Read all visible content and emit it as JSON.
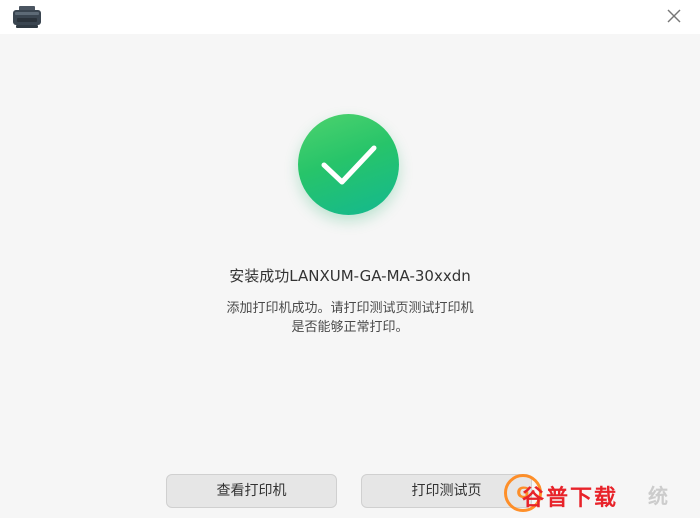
{
  "window": {
    "app_icon": "printer-icon",
    "close_icon": "close-icon"
  },
  "result": {
    "icon": "check-circle-icon",
    "accent_color": "#27c46a",
    "title": "安装成功LANXUM-GA-MA-30xxdn",
    "description": "添加打印机成功。请打印测试页测试打印机是否能够正常打印。"
  },
  "buttons": {
    "view_printer": "查看打印机",
    "print_test_page": "打印测试页"
  },
  "watermark": {
    "logo_letter": "G",
    "text": "谷普下载",
    "text_suffix": "统"
  }
}
